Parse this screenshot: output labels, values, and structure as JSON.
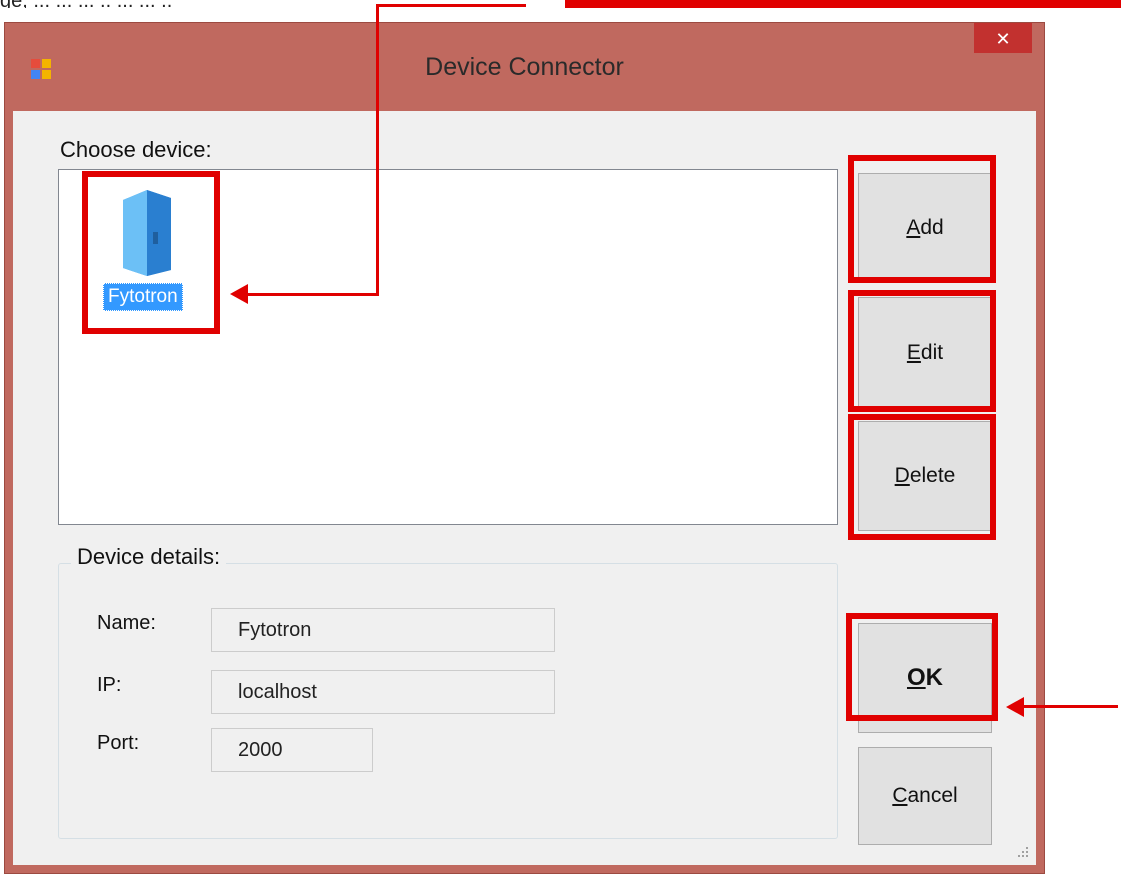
{
  "doc_fragment": {
    "left": "ge, ... ... ... ..  ... ...  ..",
    "right": ", ... ...  ... ..  .... ...  ... ...)"
  },
  "window": {
    "title": "Device Connector",
    "close_glyph": "✕"
  },
  "chooser": {
    "label": "Choose device:",
    "items": [
      {
        "label": "Fytotron",
        "icon": "server-tower-icon"
      }
    ]
  },
  "buttons": {
    "add": {
      "access": "A",
      "rest": "dd"
    },
    "edit": {
      "access": "E",
      "rest": "dit"
    },
    "delete": {
      "access": "D",
      "rest": "elete"
    },
    "ok": {
      "access": "O",
      "rest": "K"
    },
    "cancel": {
      "access": "C",
      "rest": "ancel"
    }
  },
  "details": {
    "title": "Device details:",
    "name_label": "Name:",
    "name_value": "Fytotron",
    "ip_label": "IP:",
    "ip_value": "localhost",
    "port_label": "Port:",
    "port_value": "2000"
  },
  "colors": {
    "frame": "#c0695f",
    "close": "#c2312f",
    "selection": "#3399ff",
    "annotation": "#e00000"
  }
}
